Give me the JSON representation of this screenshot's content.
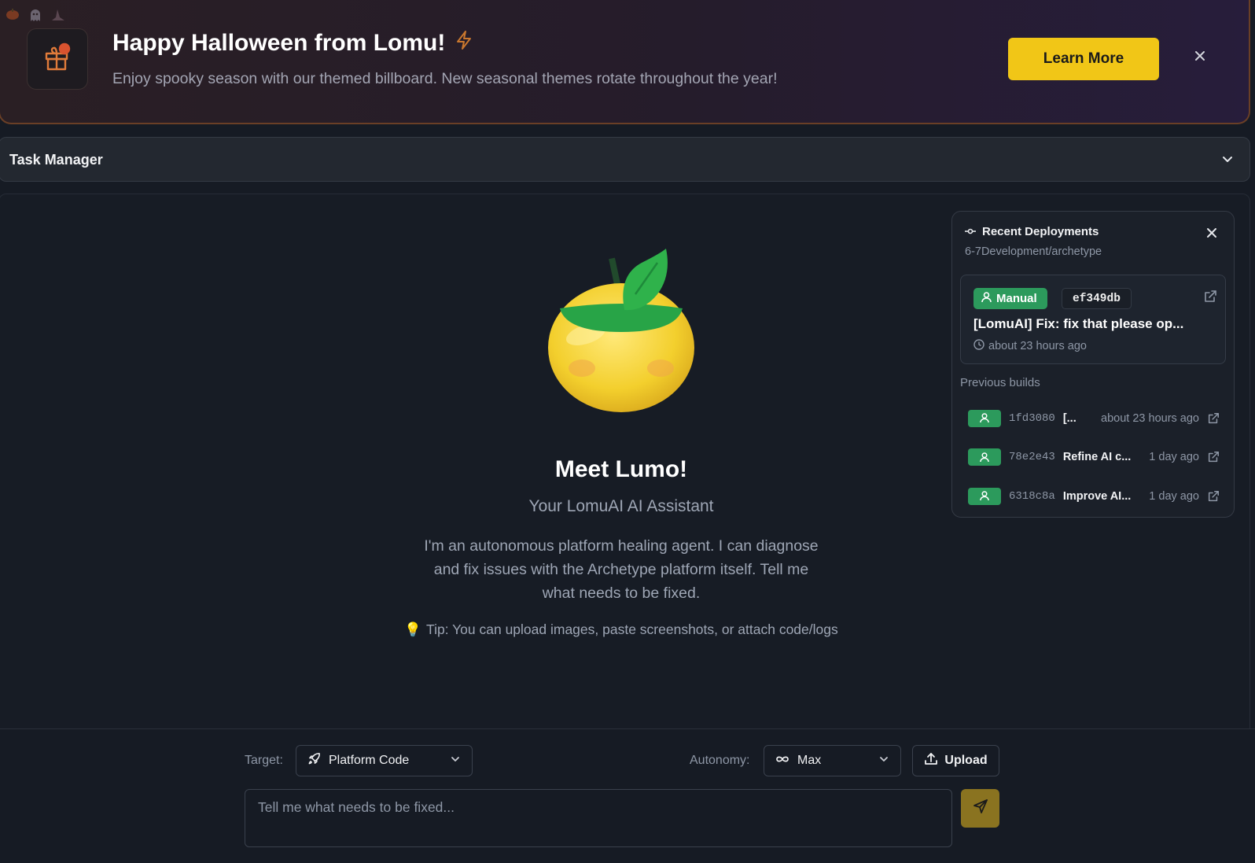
{
  "banner": {
    "title": "Happy Halloween from Lomu!",
    "subtitle": "Enjoy spooky season with our themed billboard. New seasonal themes rotate throughout the year!",
    "cta_label": "Learn More",
    "accent_color": "#f1c617"
  },
  "task_manager": {
    "title": "Task Manager"
  },
  "hero": {
    "title": "Meet Lumo!",
    "subtitle": "Your LomuAI AI Assistant",
    "description": "I'm an autonomous platform healing agent. I can diagnose and fix issues with the Archetype platform itself. Tell me what needs to be fixed.",
    "tip": "Tip: You can upload images, paste screenshots, or attach code/logs"
  },
  "deployments": {
    "title": "Recent Deployments",
    "repo": "6-7Development/archetype",
    "current": {
      "badge": "Manual",
      "hash": "ef349db",
      "message": "[LomuAI] Fix: fix that please op...",
      "time": "about 23 hours ago"
    },
    "previous_label": "Previous builds",
    "previous": [
      {
        "hash": "1fd3080",
        "message": "[...",
        "time": "about 23 hours ago"
      },
      {
        "hash": "78e2e43",
        "message": "Refine AI c...",
        "time": "1 day ago"
      },
      {
        "hash": "6318c8a",
        "message": "Improve AI...",
        "time": "1 day ago"
      }
    ],
    "status_color": "#2c9a5c"
  },
  "composer": {
    "target_label": "Target:",
    "target_value": "Platform Code",
    "autonomy_label": "Autonomy:",
    "autonomy_value": "Max",
    "upload_label": "Upload",
    "placeholder": "Tell me what needs to be fixed...",
    "send_color": "#8a7320"
  }
}
